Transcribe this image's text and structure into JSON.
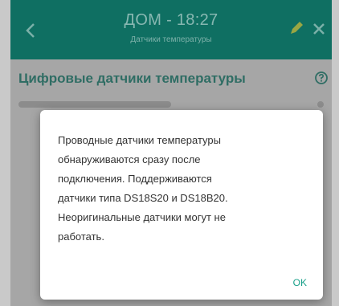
{
  "header": {
    "title": "ДОМ - 18:27",
    "subtitle": "Датчики температуры",
    "color": "#0f6f62",
    "back_icon": "chevron-left-icon",
    "edit_icon": "pencil-icon",
    "close_icon": "close-icon"
  },
  "section": {
    "title": "Цифровые датчики температуры",
    "help_icon": "help-circle-icon"
  },
  "dialog": {
    "message": "Проводные датчики температуры\nобнаруживаются сразу после\nподключения. Поддерживаются\nдатчики типа DS18S20 и DS18B20.\nНеоригинальные датчики могут не\nработать.",
    "ok_label": "OK",
    "accent_color": "#19a08a"
  }
}
